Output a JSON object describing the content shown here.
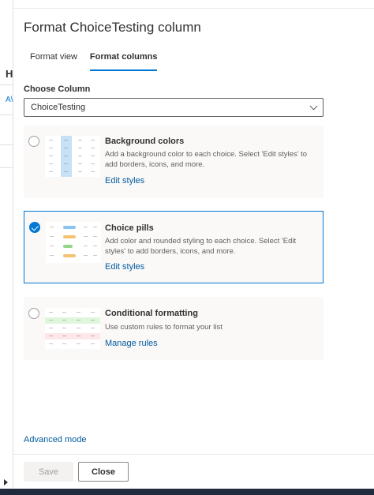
{
  "background": {
    "heading_fragment": "H",
    "link_fragment": "A\\"
  },
  "panel": {
    "title": "Format ChoiceTesting column",
    "tabs": [
      {
        "label": "Format view",
        "active": false
      },
      {
        "label": "Format columns",
        "active": true
      }
    ],
    "choose_column": {
      "label": "Choose Column",
      "selected_value": "ChoiceTesting"
    },
    "options": [
      {
        "title": "Background colors",
        "description": "Add a background color to each choice. Select 'Edit styles' to add borders, icons, and more.",
        "link": "Edit styles",
        "selected": false
      },
      {
        "title": "Choice pills",
        "description": "Add color and rounded styling to each choice. Select 'Edit styles' to add borders, icons, and more.",
        "link": "Edit styles",
        "selected": true
      },
      {
        "title": "Conditional formatting",
        "description": "Use custom rules to format your list",
        "link": "Manage rules",
        "selected": false
      }
    ],
    "advanced_mode": "Advanced mode",
    "footer": {
      "save_label": "Save",
      "save_disabled": true,
      "close_label": "Close"
    }
  },
  "colors": {
    "accent": "#0078d4",
    "link": "#005a9e",
    "card_bg": "#faf9f8",
    "pill_blue": "#8cc4f0",
    "pill_orange": "#f5c272",
    "pill_green": "#92d68a",
    "cond_green": "#dff6dd",
    "cond_red": "#fde7e9"
  },
  "icons": {
    "dropdown": "chevron-down-icon",
    "selected_radio": "checkmark-icon",
    "expand": "caret-right-icon"
  }
}
